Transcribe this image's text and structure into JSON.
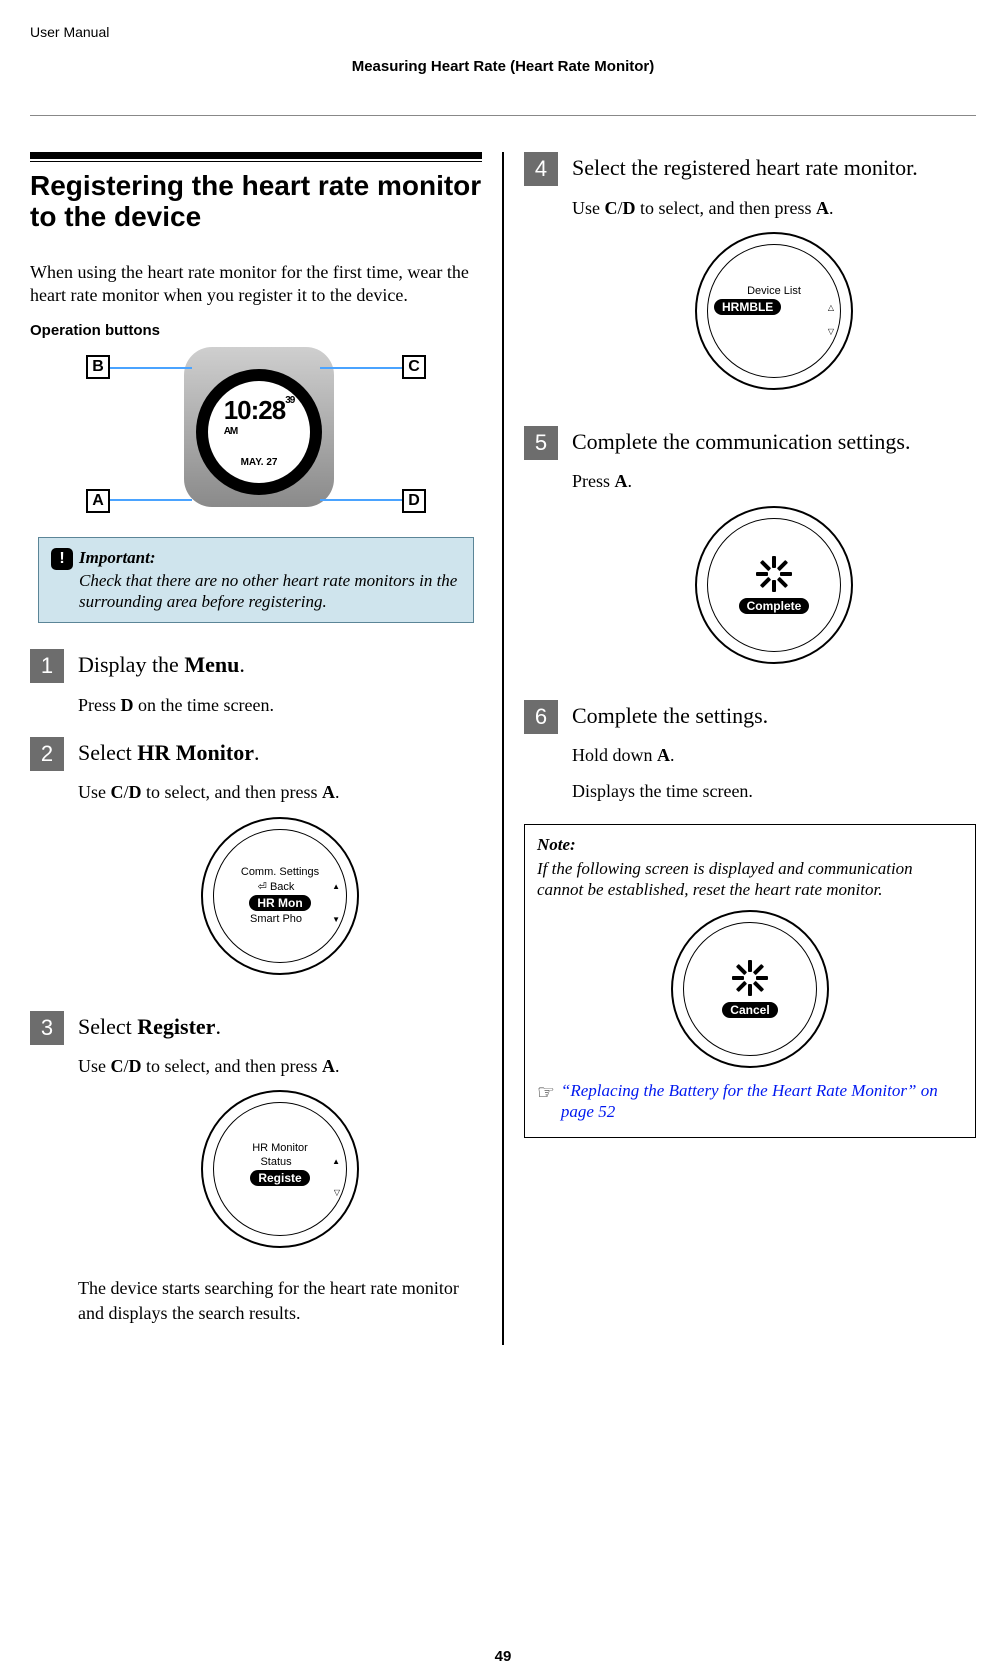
{
  "header": {
    "doc_label": "User Manual"
  },
  "breadcrumb": "Measuring Heart Rate (Heart Rate Monitor)",
  "section": {
    "title": "Registering the heart rate monitor to the device",
    "intro": "When using the heart rate monitor for the first time, wear the heart rate monitor when you register it to the device.",
    "operation_buttons_label": "Operation buttons"
  },
  "watch": {
    "time": "10:28",
    "seconds": "39",
    "ampm": "AM",
    "date": "MAY. 27",
    "buttons": {
      "B": "B",
      "A": "A",
      "C": "C",
      "D": "D"
    }
  },
  "important": {
    "title": "Important:",
    "body": "Check that there are no other heart rate monitors in the surrounding area before registering."
  },
  "steps": [
    {
      "num": "1",
      "head_pre": "Display the ",
      "head_bold": "Menu",
      "head_post": ".",
      "body_pre": "Press ",
      "body_bold": "D",
      "body_post": " on the time screen."
    },
    {
      "num": "2",
      "head_pre": "Select ",
      "head_bold": "HR Monitor",
      "head_post": ".",
      "body_pre": "Use ",
      "body_bold": "C",
      "body_mid": "/",
      "body_bold2": "D",
      "body_mid2": " to select, and then press ",
      "body_bold3": "A",
      "body_post": ".",
      "screen": {
        "hd": "Comm. Settings",
        "line1": "⏎ Back",
        "pill": "HR Mon",
        "line2": "Smart Pho"
      }
    },
    {
      "num": "3",
      "head_pre": "Select ",
      "head_bold": "Register",
      "head_post": ".",
      "body_pre": "Use ",
      "body_bold": "C",
      "body_mid": "/",
      "body_bold2": "D",
      "body_mid2": " to select, and then press ",
      "body_bold3": "A",
      "body_post": ".",
      "screen": {
        "hd": "HR Monitor",
        "line1": "Status",
        "pill": "Registe"
      },
      "after": "The device starts searching for the heart rate monitor and displays the search results."
    },
    {
      "num": "4",
      "head": "Select the registered heart rate monitor.",
      "body_pre": "Use ",
      "body_bold": "C",
      "body_mid": "/",
      "body_bold2": "D",
      "body_mid2": " to select, and then press ",
      "body_bold3": "A",
      "body_post": ".",
      "screen": {
        "hd": "Device List",
        "pill": "HRMBLE"
      }
    },
    {
      "num": "5",
      "head": "Complete the communication settings.",
      "body_pre": "Press ",
      "body_bold": "A",
      "body_post": ".",
      "screen": {
        "pill": "Complete",
        "spinner": true
      }
    },
    {
      "num": "6",
      "head": "Complete the settings.",
      "body_pre": "Hold down ",
      "body_bold": "A",
      "body_post": ".",
      "body2": "Displays the time screen."
    }
  ],
  "note": {
    "title": "Note:",
    "body": "If the following screen is displayed and communication cannot be established, reset the heart rate monitor.",
    "screen": {
      "pill": "Cancel",
      "spinner": true
    },
    "xref": "“Replacing the Battery for the Heart Rate Monitor” on page 52"
  },
  "page_number": "49"
}
